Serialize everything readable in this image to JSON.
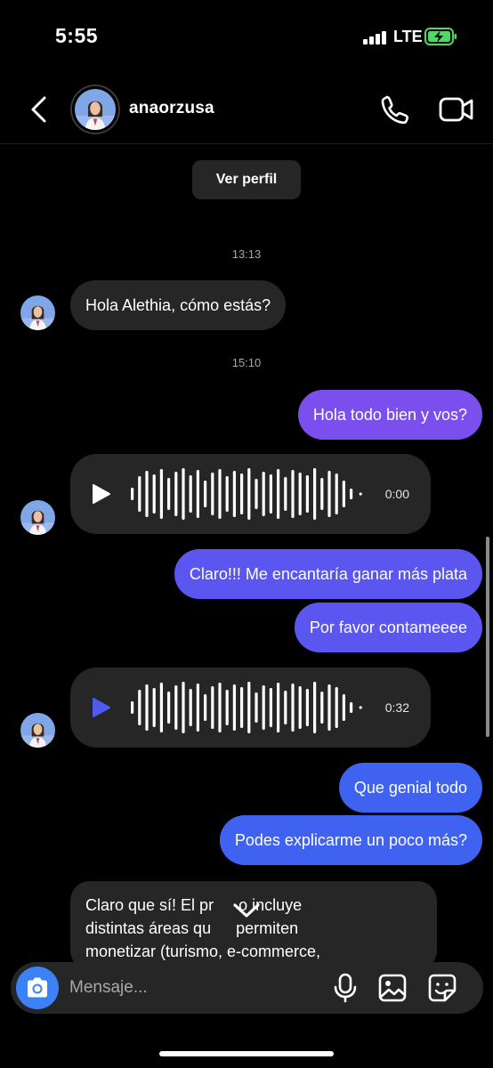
{
  "status_bar": {
    "time": "5:55",
    "carrier": "LTE"
  },
  "header": {
    "username": "anaorzusa"
  },
  "ver_perfil_label": "Ver perfil",
  "timestamps": [
    "13:13",
    "15:10"
  ],
  "messages": [
    {
      "direction": "in",
      "type": "text",
      "text": "Hola Alethia, cómo estás?"
    },
    {
      "direction": "out",
      "type": "text",
      "text": "Hola todo bien y vos?",
      "color": "#7a4fee"
    },
    {
      "direction": "in",
      "type": "voice",
      "duration": "0:00",
      "play_color": "#ffffff"
    },
    {
      "direction": "out",
      "type": "text",
      "text": "Claro!!! Me encantaría ganar más plata",
      "color": "#5a56ef"
    },
    {
      "direction": "out",
      "type": "text",
      "text": "Por favor contameeee",
      "color": "#5a56ef"
    },
    {
      "direction": "in",
      "type": "voice",
      "duration": "0:32",
      "play_color": "#4f5bf0"
    },
    {
      "direction": "out",
      "type": "text",
      "text": "Que genial todo",
      "color": "#3f63f0"
    },
    {
      "direction": "out",
      "type": "text",
      "text": "Podes explicarme un poco más?",
      "color": "#3f63f0"
    },
    {
      "direction": "in",
      "type": "text",
      "text_lines": [
        "Claro que sí! El pr",
        "o incluye",
        "distintas áreas qu",
        "permiten",
        "monetizar (turismo, e-commerce,"
      ]
    }
  ],
  "composer": {
    "placeholder": "Mensaje..."
  },
  "icons": {
    "back": "chevron-left-icon",
    "call": "phone-icon",
    "video": "video-camera-icon",
    "play": "play-icon",
    "scroll_down": "chevron-down-icon",
    "camera": "camera-icon",
    "mic": "microphone-icon",
    "gallery": "image-icon",
    "sticker": "sticker-icon"
  },
  "colors": {
    "background": "#000000",
    "incoming_bubble": "#262626",
    "camera_button": "#3b82f6",
    "battery_charging": "#4cd964"
  }
}
